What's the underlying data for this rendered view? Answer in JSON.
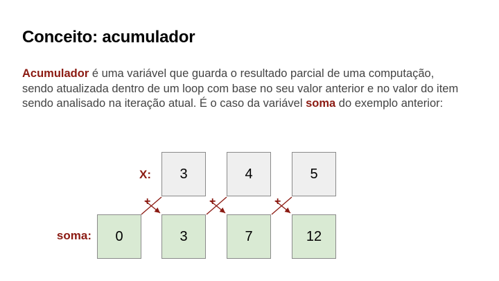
{
  "slide": {
    "title": "Conceito: acumulador",
    "paragraph": {
      "term": "Acumulador",
      "text1": " é uma variável que guarda o resultado parcial de uma computação, sendo atualizada dentro de um loop com base no seu valor anterior e no valor do item sendo analisado na iteração atual. É o caso da variável ",
      "var": "soma",
      "text2": " do exemplo anterior:"
    }
  },
  "diagram": {
    "x_label": "X:",
    "soma_label": "soma:",
    "x_values": [
      "3",
      "4",
      "5"
    ],
    "soma_values": [
      "0",
      "3",
      "7",
      "12"
    ],
    "operator": "+"
  },
  "colors": {
    "accent": "#8b1a12",
    "x_box": "#efefef",
    "soma_box": "#d9ead3",
    "text": "#434343"
  }
}
